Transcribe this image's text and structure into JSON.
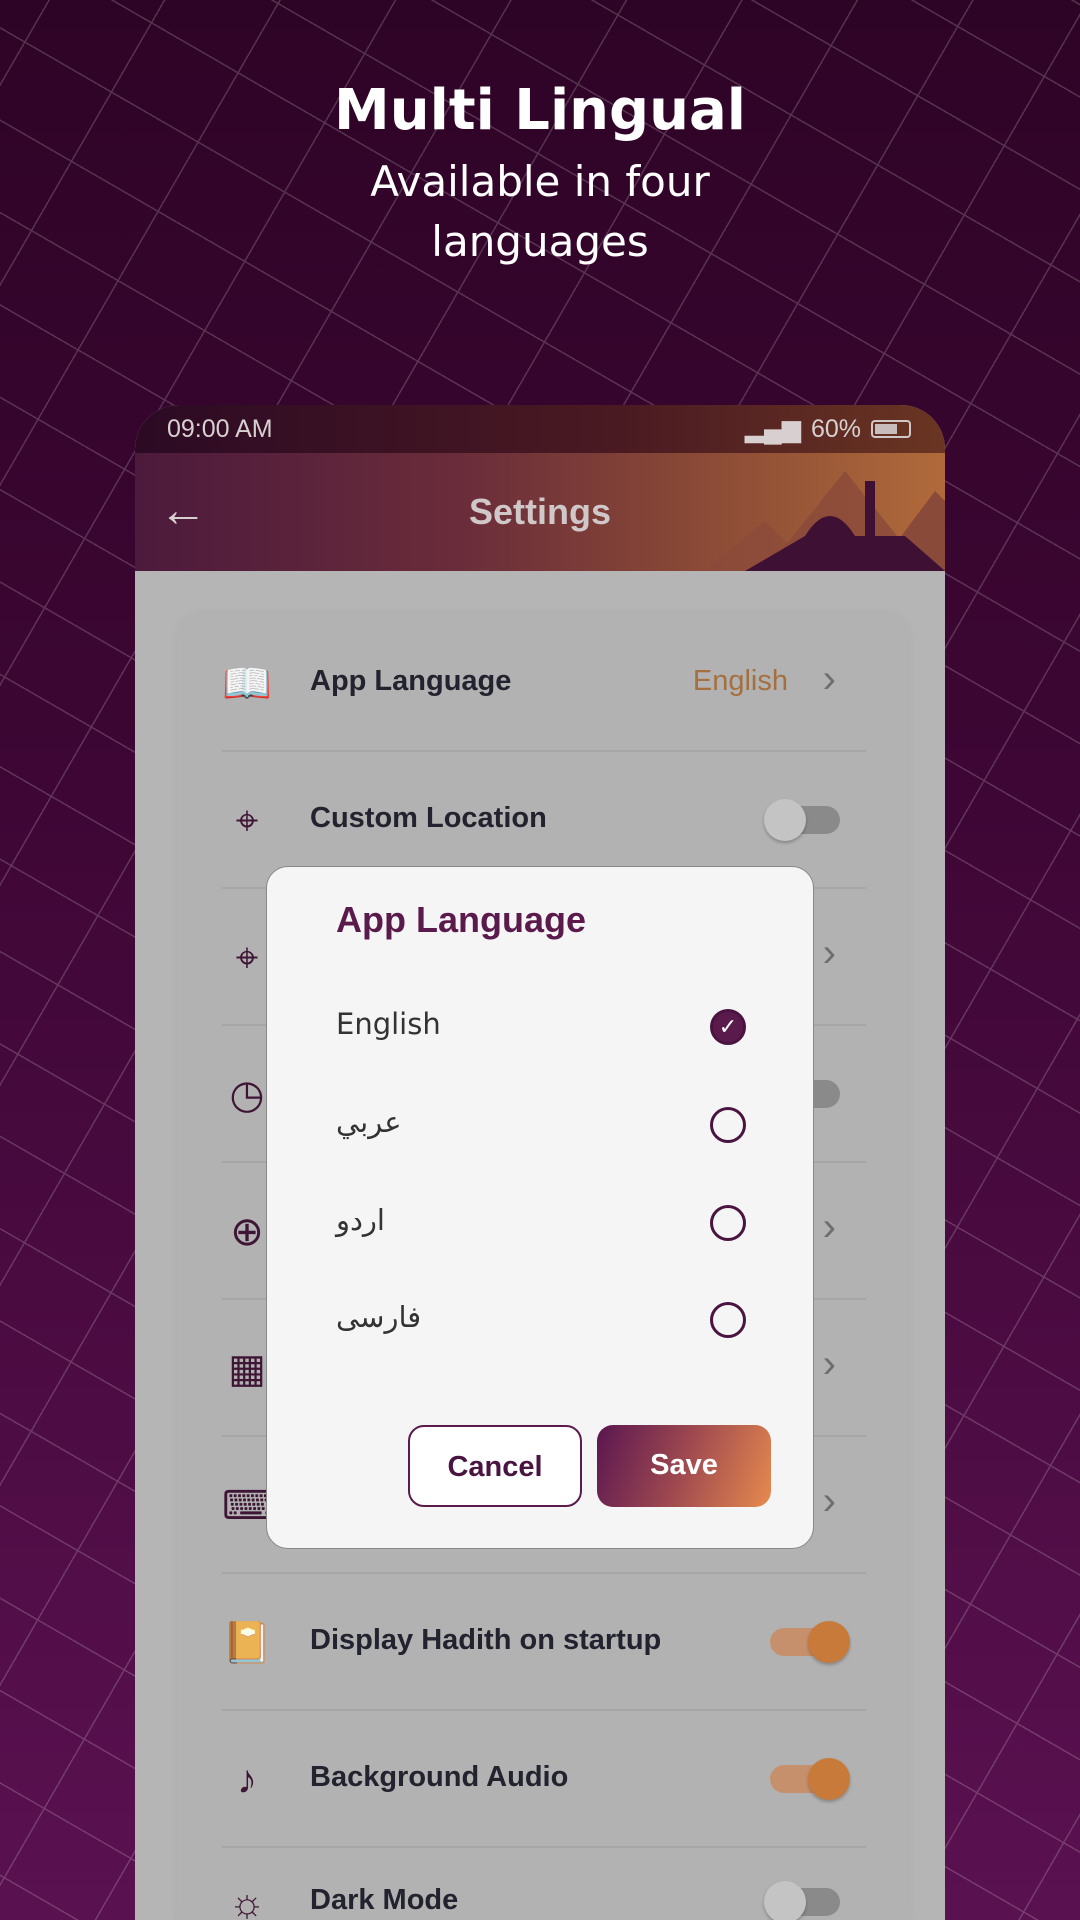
{
  "hero": {
    "title": "Multi Lingual",
    "subtitle": "Available in four languages"
  },
  "status_bar": {
    "time": "09:00 AM",
    "battery": "60%"
  },
  "header": {
    "title": "Settings",
    "back_icon": "arrow-left-icon"
  },
  "settings": {
    "rows": [
      {
        "label": "App Language",
        "value": "English",
        "icon": "book-icon",
        "control": "chevron"
      },
      {
        "label": "Custom Location",
        "icon": "location-pin-icon",
        "control": "toggle",
        "on": false
      },
      {
        "icon": "location-pin-icon",
        "control": "chevron"
      },
      {
        "icon": "clock-icon",
        "control": "toggle"
      },
      {
        "icon": "alarm-add-icon",
        "control": "chevron"
      },
      {
        "icon": "calendar-icon",
        "control": "chevron"
      },
      {
        "icon": "keyboard-icon",
        "control": "chevron"
      },
      {
        "label": "Display Hadith on startup",
        "icon": "hadith-book-icon",
        "control": "toggle",
        "on": true
      },
      {
        "label": "Background Audio",
        "icon": "music-note-icon",
        "control": "toggle",
        "on": true
      },
      {
        "label": "Dark Mode",
        "icon": "sun-icon",
        "control": "toggle",
        "on": false
      }
    ]
  },
  "dialog": {
    "title": "App Language",
    "options": [
      {
        "label": "English",
        "selected": true
      },
      {
        "label": "عربي",
        "selected": false
      },
      {
        "label": "اردو",
        "selected": false
      },
      {
        "label": "فارسی",
        "selected": false
      }
    ],
    "cancel": "Cancel",
    "save": "Save"
  },
  "colors": {
    "brand": "#5a1a4c",
    "accent": "#e68a4e"
  }
}
